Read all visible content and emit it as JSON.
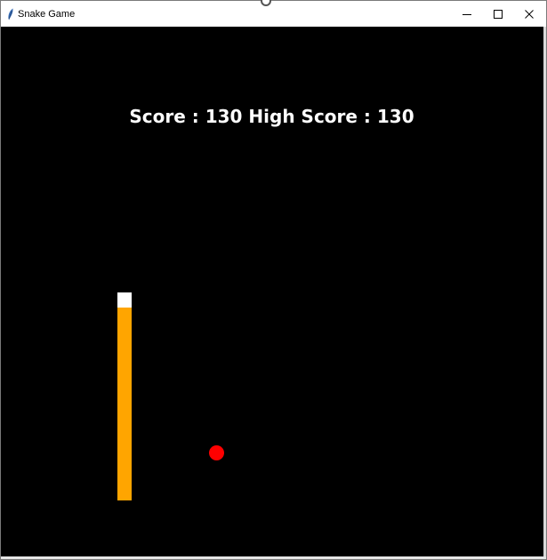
{
  "window": {
    "title": "Snake Game",
    "app_icon": "feather-icon",
    "controls": {
      "minimize_icon": "minimize-icon",
      "maximize_icon": "maximize-icon",
      "close_icon": "close-icon"
    }
  },
  "game": {
    "score_label": "Score",
    "score": 130,
    "high_score_label": "High Score",
    "high_score": 130,
    "score_text": "Score : 130 High Score : 130",
    "colors": {
      "background": "#000000",
      "text": "#ffffff",
      "snake_head": "#ffffff",
      "snake_body": "#ffa500",
      "food": "#ff0000"
    }
  }
}
